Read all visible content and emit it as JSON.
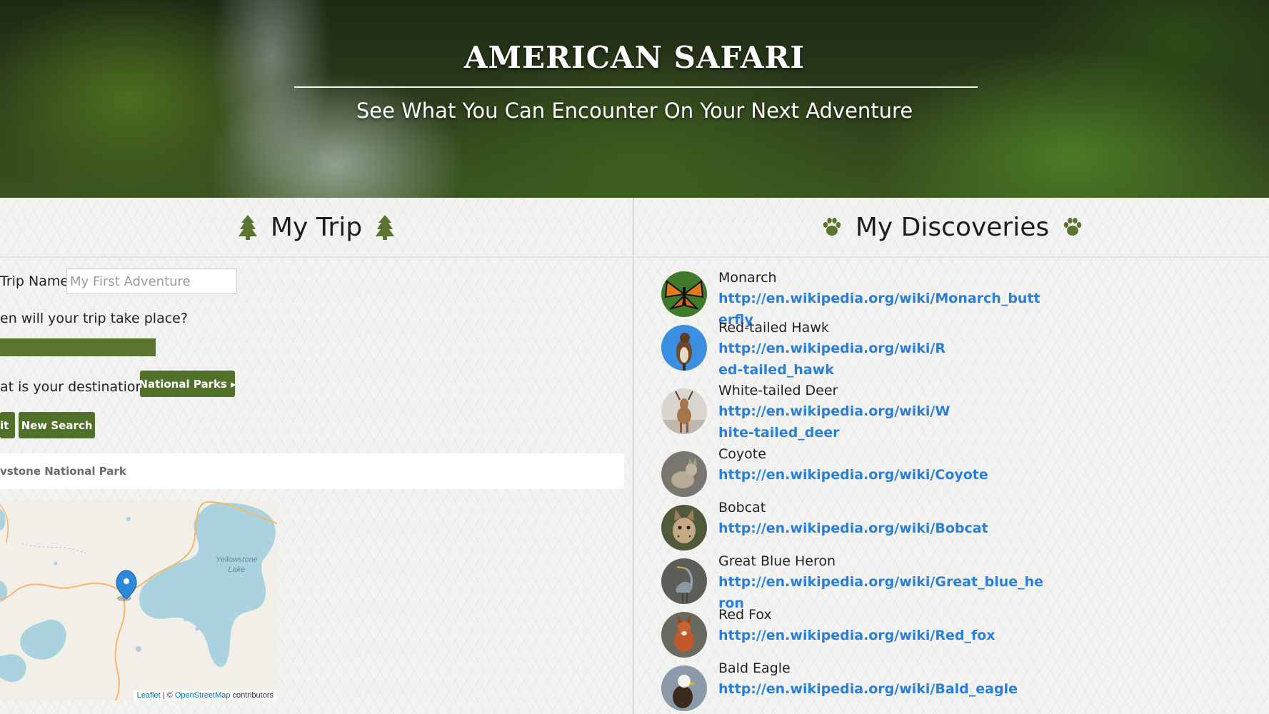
{
  "header": {
    "title": "AMERICAN SAFARI",
    "subtitle": "See What You Can Encounter On Your Next Adventure"
  },
  "trip_panel": {
    "title": "My Trip",
    "icon": "tree-icon",
    "trip_name_label": "Trip Name",
    "trip_name_placeholder": "My First Adventure",
    "trip_name_value": "",
    "date_question": "en will your trip take place?",
    "destination_question": "at is your destination?",
    "destination_button": "National Parks ▸",
    "submit_button": "it",
    "new_search_button": "New Search",
    "selected_park": "vstone National Park"
  },
  "map": {
    "lake_label": "Yellowstone\nLake",
    "attribution_leaflet": "Leaflet",
    "attribution_sep": " | © ",
    "attribution_osm": "OpenStreetMap",
    "attribution_tail": " contributors"
  },
  "discoveries_panel": {
    "title": "My Discoveries",
    "icon": "paw-icon",
    "items": [
      {
        "name": "Monarch",
        "link": "http://en.wikipedia.org/wiki/Monarch_butterfly"
      },
      {
        "name": "Red-tailed Hawk",
        "link": "http://en.wikipedia.org/wiki/Red-tailed_hawk"
      },
      {
        "name": "White-tailed Deer",
        "link": "http://en.wikipedia.org/wiki/White-tailed_deer"
      },
      {
        "name": "Coyote",
        "link": "http://en.wikipedia.org/wiki/Coyote"
      },
      {
        "name": "Bobcat",
        "link": "http://en.wikipedia.org/wiki/Bobcat"
      },
      {
        "name": "Great Blue Heron",
        "link": "http://en.wikipedia.org/wiki/Great_blue_heron"
      },
      {
        "name": "Red Fox",
        "link": "http://en.wikipedia.org/wiki/Red_fox"
      },
      {
        "name": "Bald Eagle",
        "link": "http://en.wikipedia.org/wiki/Bald_eagle"
      }
    ]
  },
  "colors": {
    "accent_green": "#51702a",
    "link_blue": "#2a7fd9"
  }
}
